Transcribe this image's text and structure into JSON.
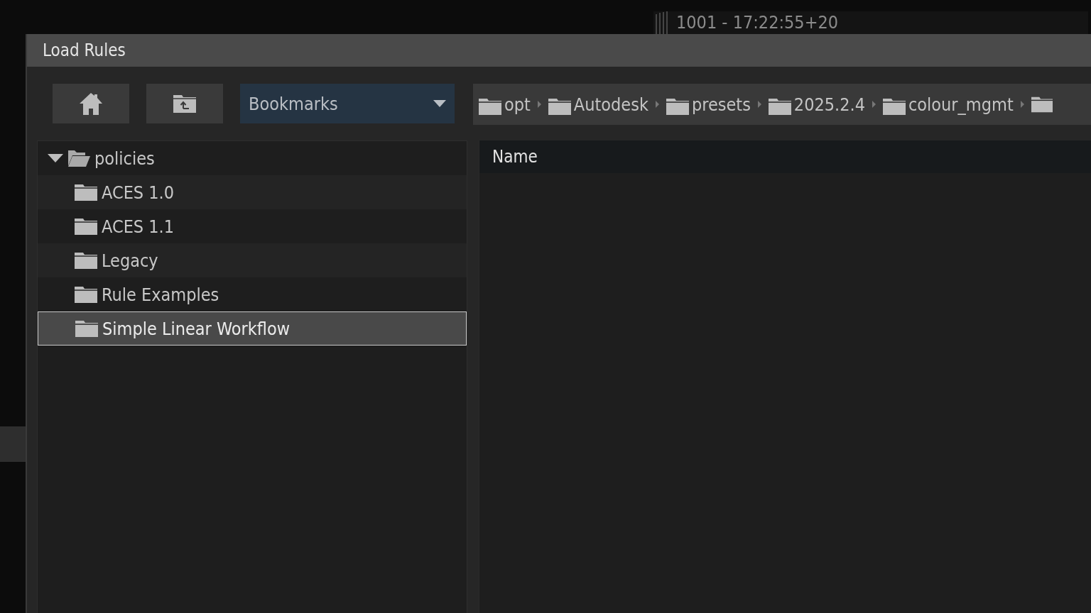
{
  "timecode": "1001 - 17:22:55+20",
  "window": {
    "title": "Load Rules"
  },
  "toolbar": {
    "bookmarks": {
      "value": "Bookmarks"
    }
  },
  "breadcrumbs": [
    {
      "label": "opt"
    },
    {
      "label": "Autodesk"
    },
    {
      "label": "presets"
    },
    {
      "label": "2025.2.4"
    },
    {
      "label": "colour_mgmt"
    }
  ],
  "tree": [
    {
      "label": "policies",
      "expanded": true,
      "selected": false,
      "children": [
        {
          "label": "ACES 1.0",
          "selected": false
        },
        {
          "label": "ACES 1.1",
          "selected": false
        },
        {
          "label": "Legacy",
          "selected": false
        },
        {
          "label": "Rule Examples",
          "selected": false
        },
        {
          "label": "Simple Linear Workflow",
          "selected": true
        }
      ]
    }
  ],
  "file_list": {
    "columns": [
      "Name"
    ]
  }
}
